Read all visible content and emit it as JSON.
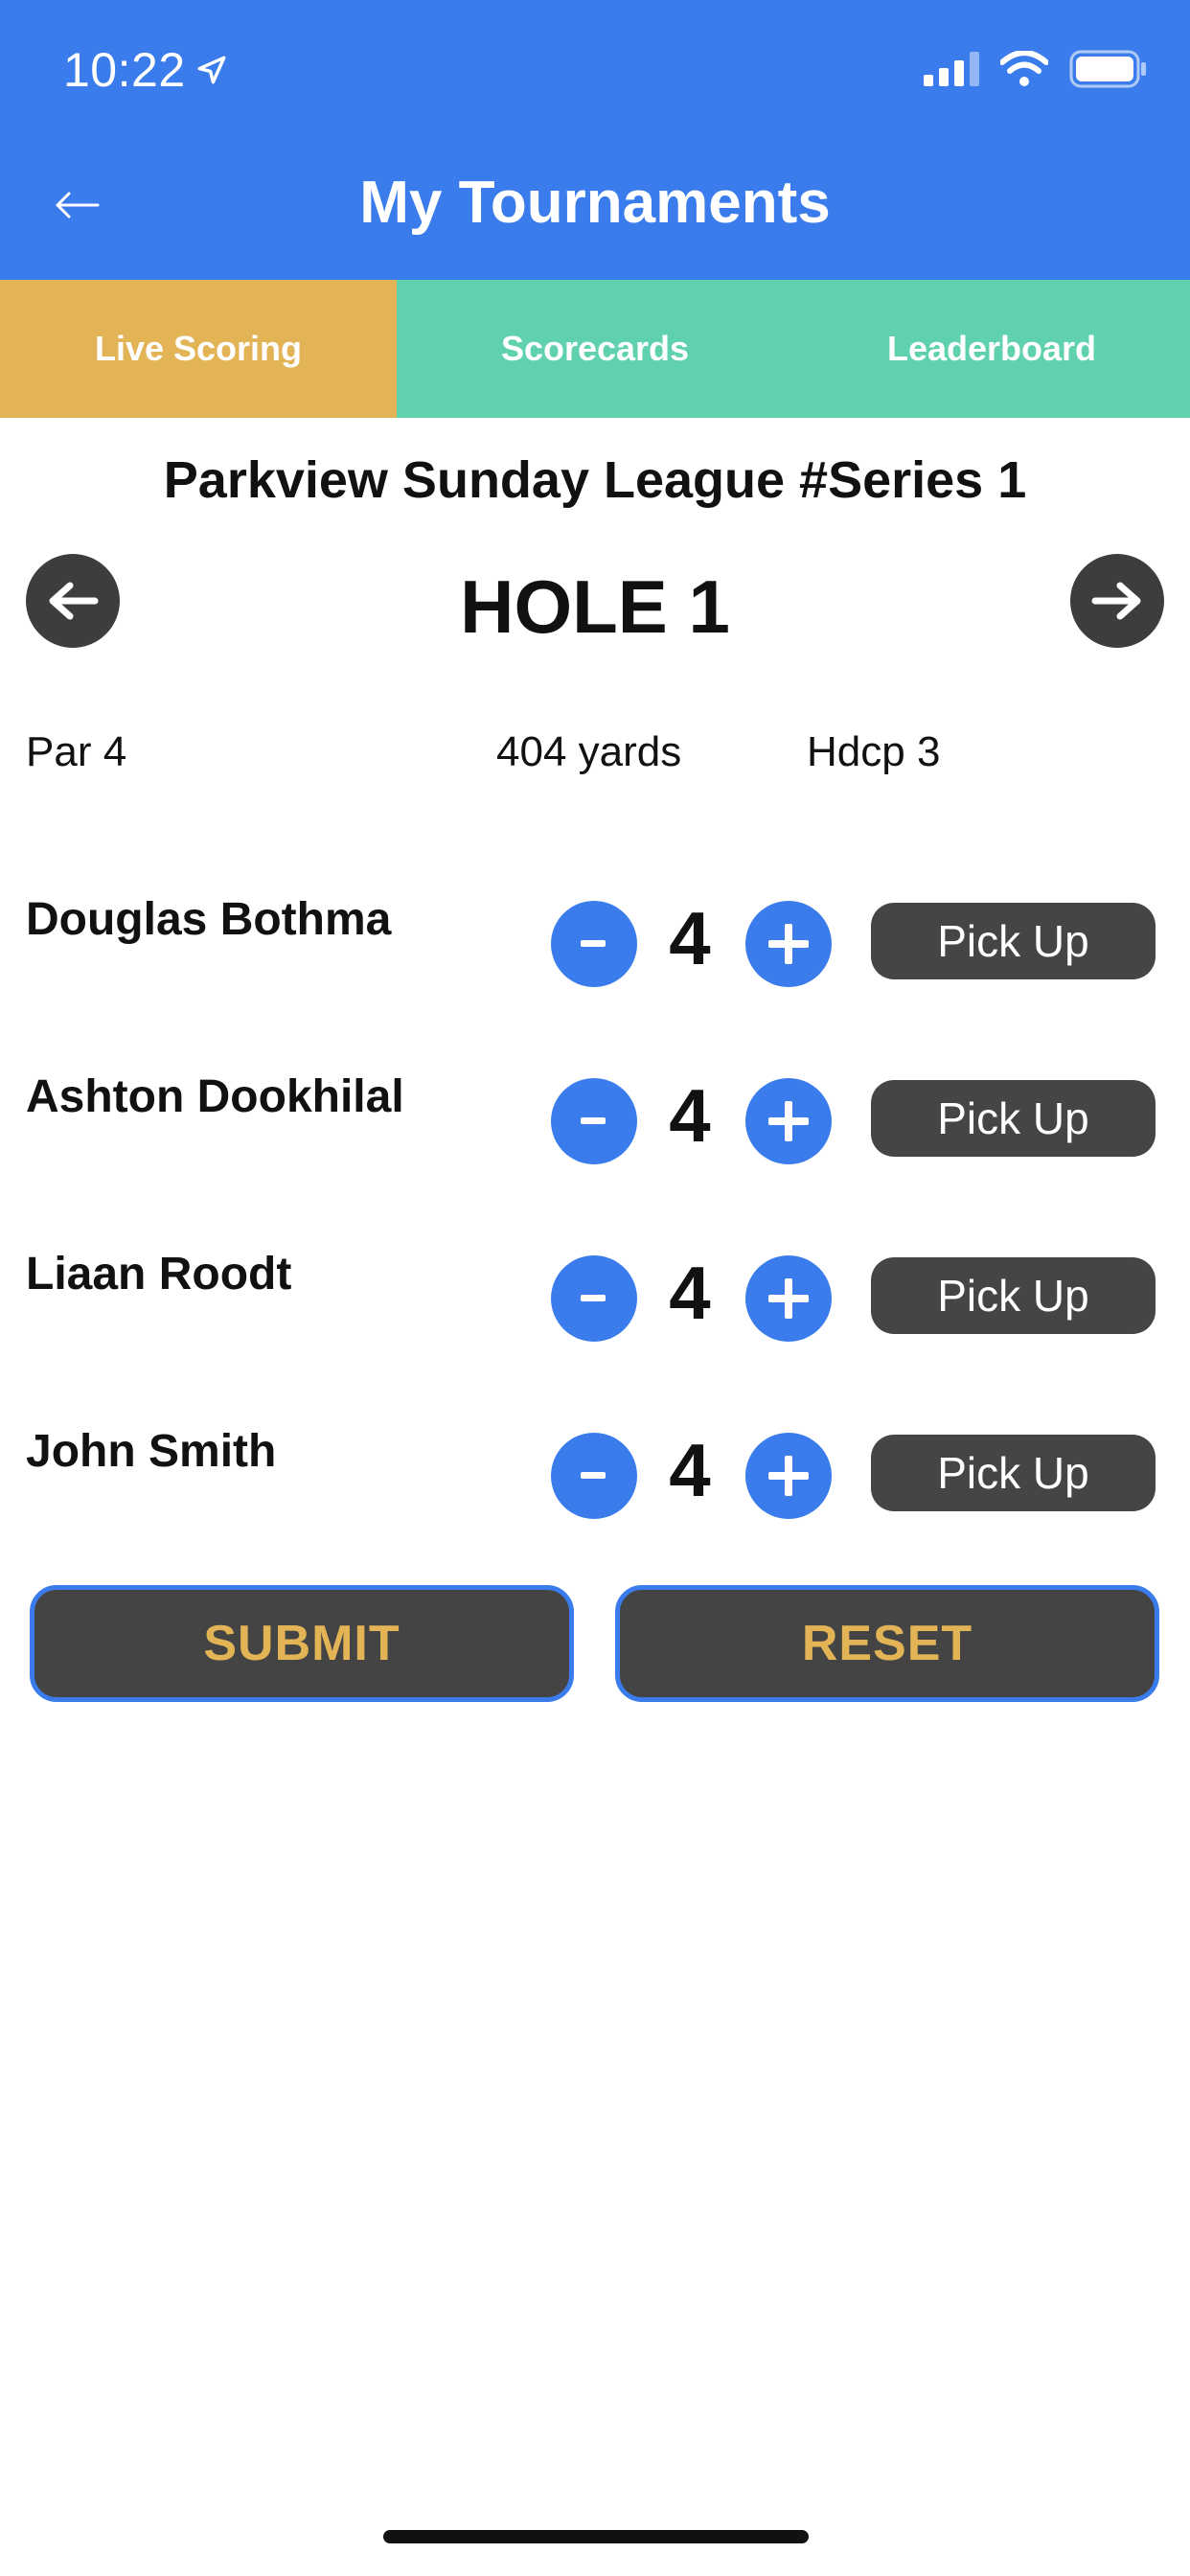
{
  "status_bar": {
    "time": "10:22",
    "icons": [
      "location-arrow-icon",
      "signal-icon",
      "wifi-icon",
      "battery-icon"
    ]
  },
  "header": {
    "back_icon": "arrow-left-icon",
    "title": "My Tournaments",
    "background_color": "#3b7ced"
  },
  "tabs": [
    {
      "label": "Live Scoring",
      "active": true,
      "color": "#e3b455"
    },
    {
      "label": "Scorecards",
      "active": false,
      "color": "#5fd1ae"
    },
    {
      "label": "Leaderboard",
      "active": false,
      "color": "#5fd1ae"
    }
  ],
  "round": {
    "league": "Parkview Sunday League #Series 1",
    "hole_title": "HOLE 1",
    "par": "Par 4",
    "yards": "404 yards",
    "hdcp": "Hdcp 3"
  },
  "score_controls": {
    "minus_label": "-",
    "plus_label": "+",
    "pickup_label": "Pick Up"
  },
  "players": [
    {
      "name": "Douglas Bothma",
      "score": "4"
    },
    {
      "name": "Ashton Dookhilal",
      "score": "4"
    },
    {
      "name": "Liaan Roodt",
      "score": "4"
    },
    {
      "name": "John Smith",
      "score": "4"
    }
  ],
  "actions": {
    "submit_label": "SUBMIT",
    "reset_label": "RESET"
  },
  "colors": {
    "accent_blue": "#3b7ced",
    "gold": "#e3b455",
    "teal": "#5fd1ae",
    "dark_button": "#454545"
  }
}
